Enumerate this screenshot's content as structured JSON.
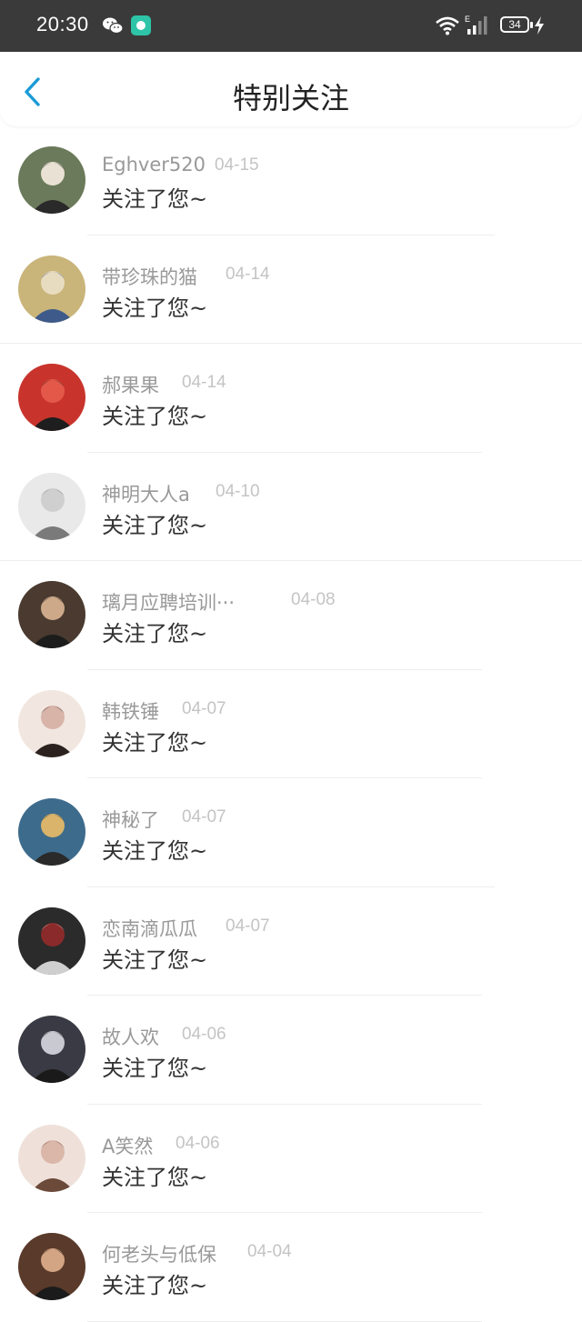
{
  "status_bar": {
    "time": "20:30",
    "battery": "34",
    "icons": [
      "wechat-icon",
      "app-icon",
      "wifi-icon",
      "signal-icon",
      "battery-icon",
      "charging-icon"
    ]
  },
  "header": {
    "title": "特别关注",
    "back_icon": "chevron-left-icon"
  },
  "accent_color": "#1a9bd7",
  "followers": [
    {
      "name": "Eghver520",
      "date": "04-15",
      "message": "关注了您~"
    },
    {
      "name": "带珍珠的猫",
      "date": "04-14",
      "message": "关注了您~"
    },
    {
      "name": "郝果果",
      "date": "04-14",
      "message": "关注了您~"
    },
    {
      "name": "神明大人a",
      "date": "04-10",
      "message": "关注了您~"
    },
    {
      "name": "璃月应聘培训···",
      "date": "04-08",
      "message": "关注了您~"
    },
    {
      "name": "韩铁锤",
      "date": "04-07",
      "message": "关注了您~"
    },
    {
      "name": "神秘了",
      "date": "04-07",
      "message": "关注了您~"
    },
    {
      "name": "恋南滴瓜瓜",
      "date": "04-07",
      "message": "关注了您~"
    },
    {
      "name": "故人欢",
      "date": "04-06",
      "message": "关注了您~"
    },
    {
      "name": "A笑然",
      "date": "04-06",
      "message": "关注了您~"
    },
    {
      "name": "何老头与低保",
      "date": "04-04",
      "message": "关注了您~"
    }
  ]
}
